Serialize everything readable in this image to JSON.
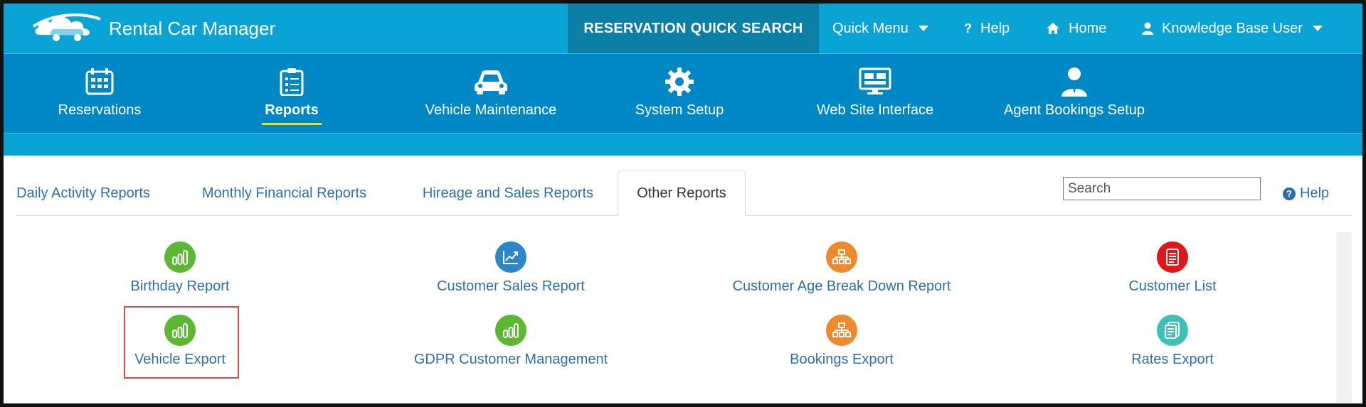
{
  "app": {
    "title": "Rental Car Manager"
  },
  "topbar": {
    "quick_search": "RESERVATION QUICK SEARCH",
    "quick_menu": "Quick Menu",
    "help": "Help",
    "home": "Home",
    "user": "Knowledge Base User"
  },
  "mainnav": {
    "items": [
      {
        "label": "Reservations",
        "icon": "calendar-icon"
      },
      {
        "label": "Reports",
        "icon": "checklist-icon",
        "active": true
      },
      {
        "label": "Vehicle Maintenance",
        "icon": "car-icon"
      },
      {
        "label": "System Setup",
        "icon": "gear-icon"
      },
      {
        "label": "Web Site Interface",
        "icon": "monitor-icon"
      },
      {
        "label": "Agent Bookings Setup",
        "icon": "agent-icon"
      }
    ]
  },
  "tabs": {
    "items": [
      {
        "label": "Daily Activity Reports"
      },
      {
        "label": "Monthly Financial Reports"
      },
      {
        "label": "Hireage and Sales Reports"
      },
      {
        "label": "Other Reports",
        "active": true
      }
    ],
    "search_placeholder": "Search",
    "help": "Help"
  },
  "reports": [
    {
      "label": "Birthday Report",
      "icon": "bar-chart-icon",
      "color": "#5cb832"
    },
    {
      "label": "Customer Sales Report",
      "icon": "line-chart-icon",
      "color": "#2b87c8"
    },
    {
      "label": "Customer Age Break Down Report",
      "icon": "hierarchy-icon",
      "color": "#f0892a"
    },
    {
      "label": "Customer List",
      "icon": "document-icon",
      "color": "#e0161b"
    },
    {
      "label": "Vehicle Export",
      "icon": "bar-chart-icon",
      "color": "#5cb832",
      "highlighted": true
    },
    {
      "label": "GDPR Customer Management",
      "icon": "bar-chart-icon",
      "color": "#5cb832"
    },
    {
      "label": "Bookings Export",
      "icon": "hierarchy-icon",
      "color": "#f0892a"
    },
    {
      "label": "Rates Export",
      "icon": "documents-icon",
      "color": "#3fbfb8"
    }
  ],
  "colors": {
    "topbar": "#0aa3d6",
    "nav": "#0087c5",
    "quick_search_bg": "#0b7fa6",
    "link": "#2d6fa8",
    "active_underline": "#e8e220",
    "highlight_border": "#e0474c"
  }
}
